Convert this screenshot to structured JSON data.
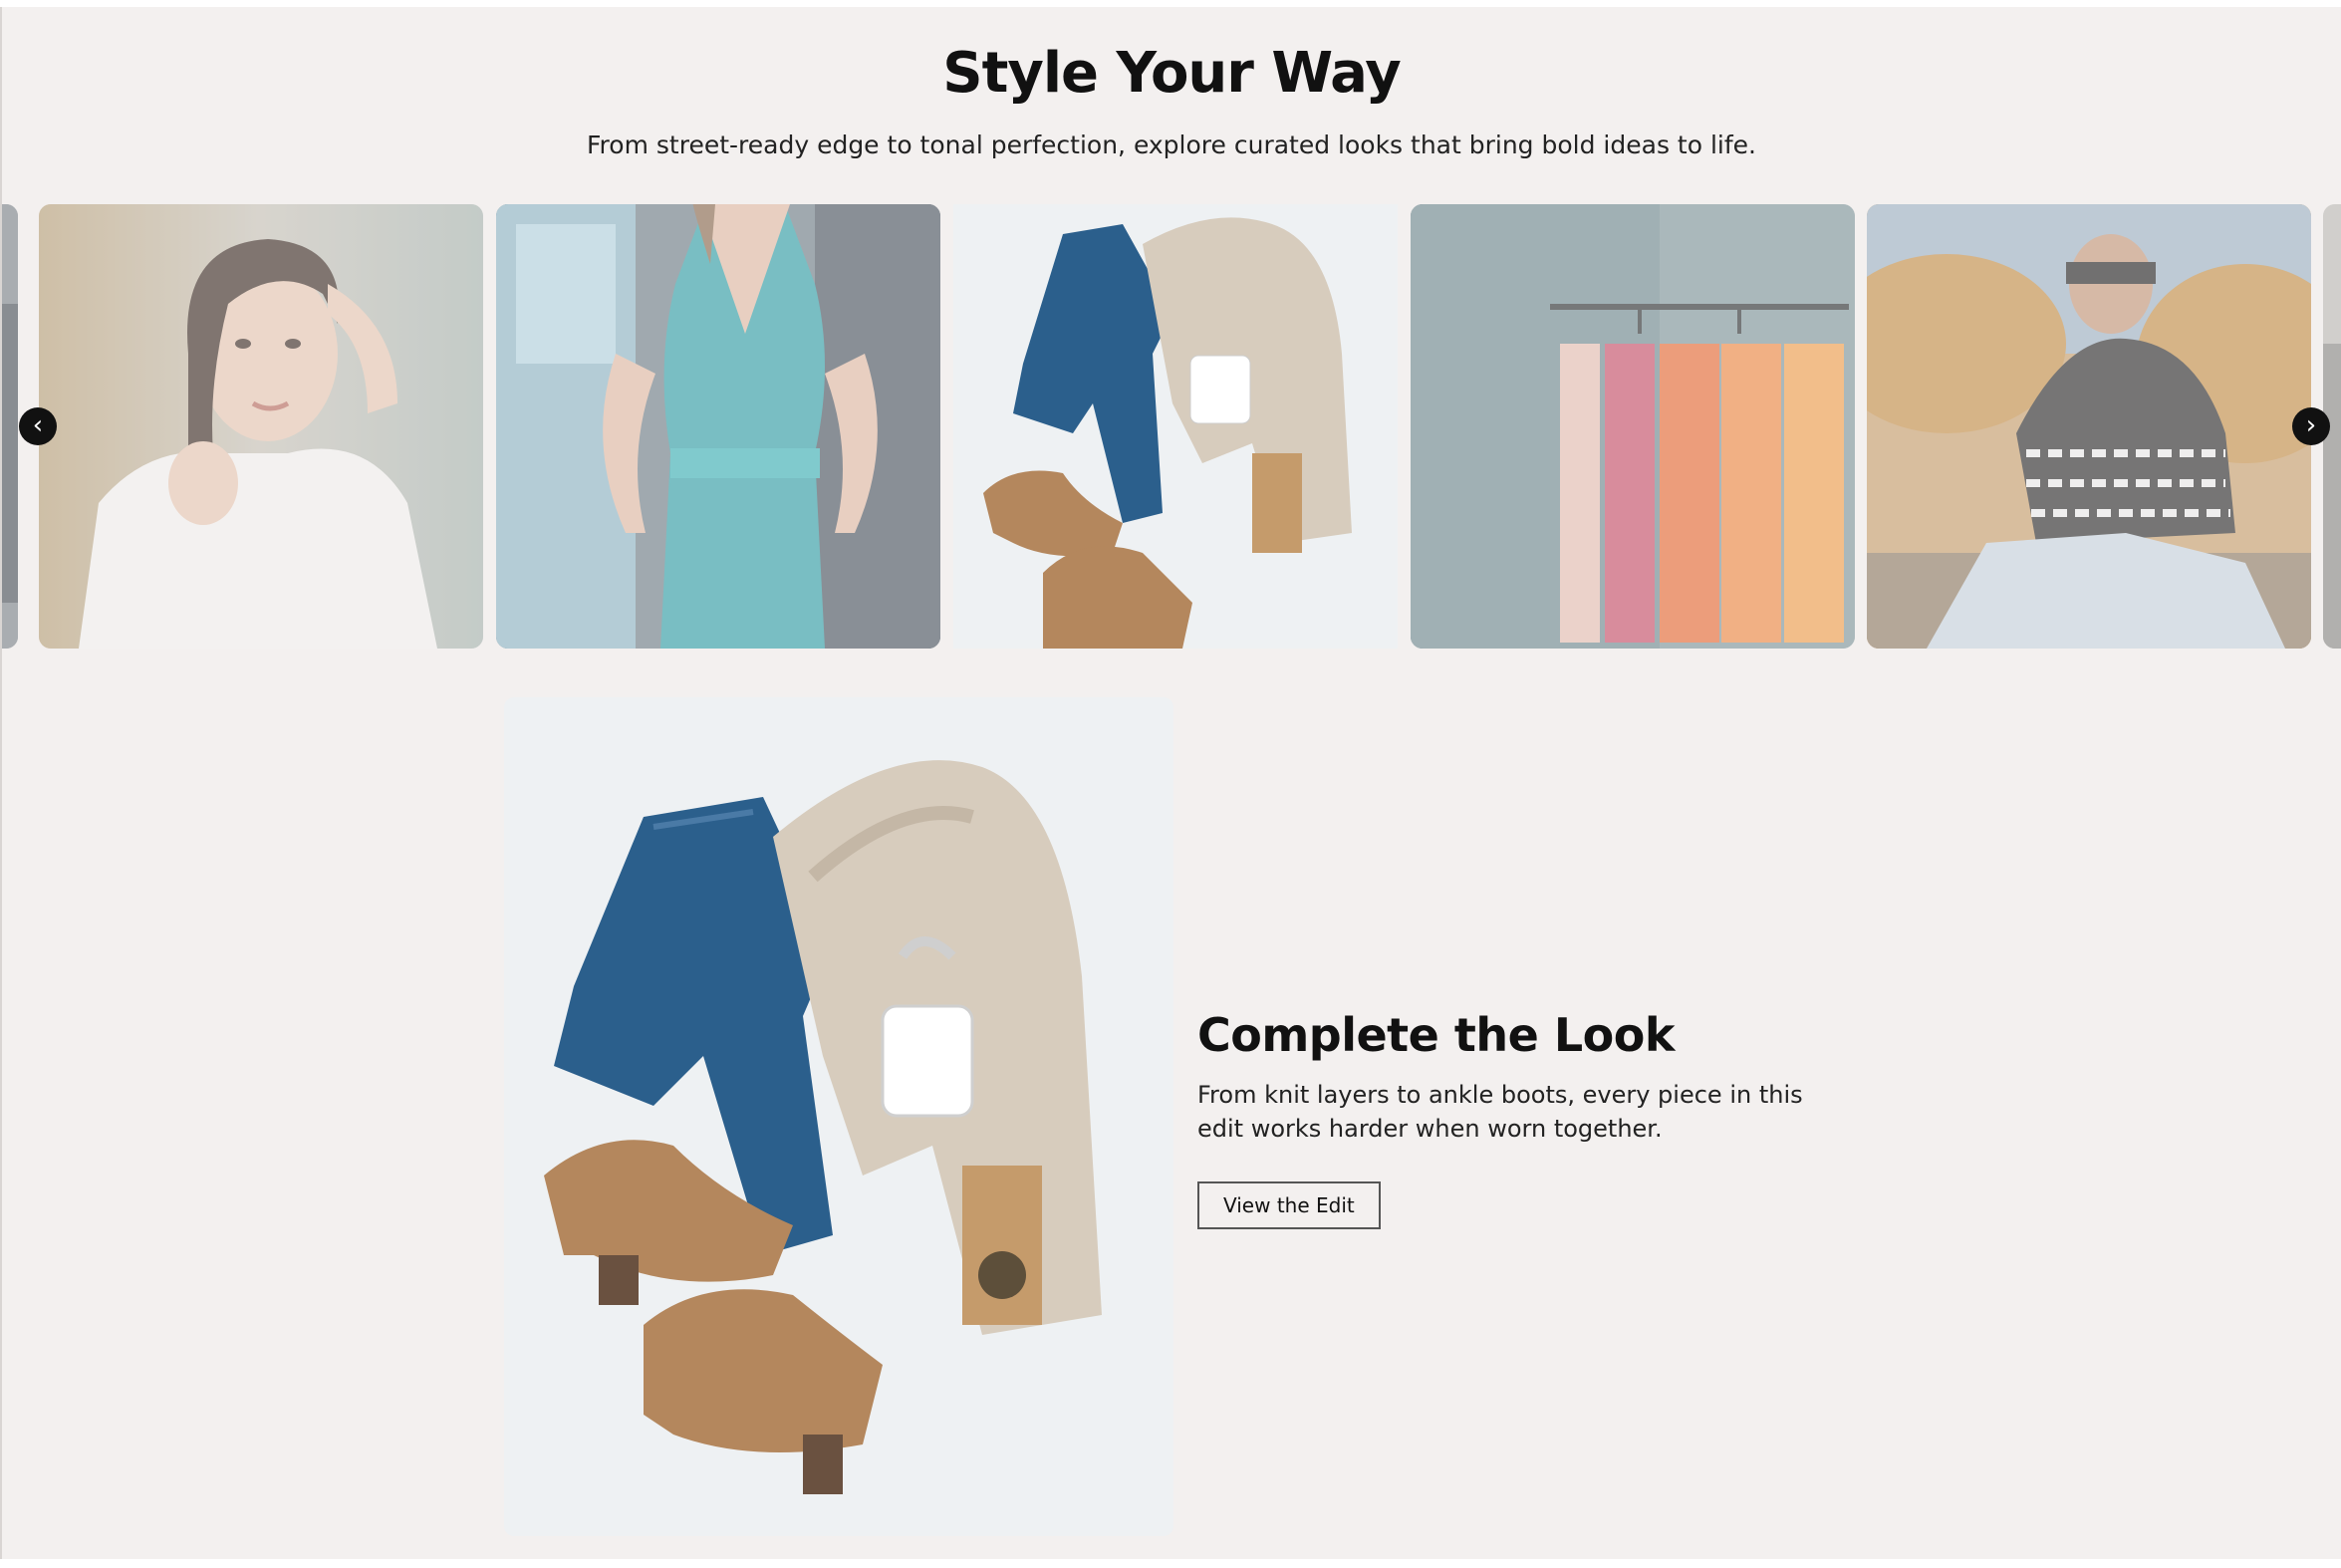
{
  "section": {
    "title": "Style Your Way",
    "subtitle": "From street-ready edge to tonal perfection, explore curated looks that bring bold ideas to life."
  },
  "carousel": {
    "prev_icon": "chevron-left-icon",
    "next_icon": "chevron-right-icon",
    "prev_glyph": "‹",
    "next_glyph": "›",
    "slides": [
      {
        "subject": "woman-in-white-shirt"
      },
      {
        "subject": "teal-halter-jumpsuit"
      },
      {
        "subject": "flatlay-jeans-sweater-boots"
      },
      {
        "subject": "clothing-rack"
      },
      {
        "subject": "woman-in-patterned-sweater"
      }
    ]
  },
  "feature": {
    "title": "Complete the Look",
    "description": "From knit layers to ankle boots, every piece in this edit works harder when worn together.",
    "cta_label": "View the Edit"
  },
  "colors": {
    "background": "#f3f0ef",
    "text": "#111111",
    "nav_button": "#111111"
  }
}
